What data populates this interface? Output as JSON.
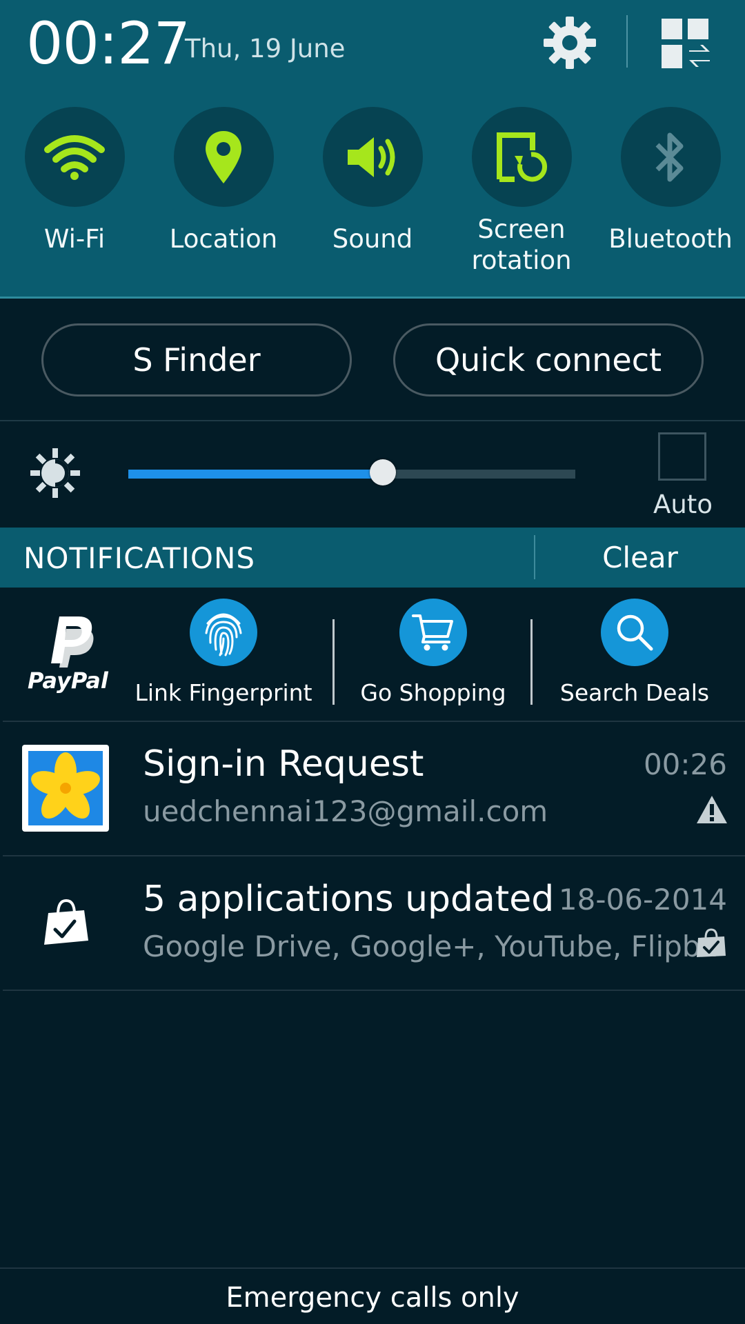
{
  "header": {
    "time": "00:27",
    "date": "Thu, 19 June",
    "settings_icon": "gear-icon",
    "quickpanel_icon": "quick-settings-edit-icon"
  },
  "quick_toggles": [
    {
      "label": "Wi-Fi",
      "icon": "wifi-icon",
      "state": "on"
    },
    {
      "label": "Location",
      "icon": "location-pin-icon",
      "state": "on"
    },
    {
      "label": "Sound",
      "icon": "speaker-icon",
      "state": "on"
    },
    {
      "label": "Screen\nrotation",
      "icon": "screen-rotation-icon",
      "state": "on"
    },
    {
      "label": "Bluetooth",
      "icon": "bluetooth-icon",
      "state": "off"
    }
  ],
  "buttons": {
    "s_finder": "S Finder",
    "quick_connect": "Quick connect"
  },
  "brightness": {
    "level": 0.57,
    "auto_label": "Auto",
    "auto_checked": false
  },
  "notifications_bar": {
    "title": "NOTIFICATIONS",
    "clear_label": "Clear"
  },
  "paypal": {
    "logo_text": "PayPal",
    "actions": [
      {
        "label": "Link Fingerprint",
        "icon": "fingerprint-icon"
      },
      {
        "label": "Go Shopping",
        "icon": "shopping-cart-icon"
      },
      {
        "label": "Search Deals",
        "icon": "search-icon"
      }
    ]
  },
  "notifications": [
    {
      "title": "Sign-in Request",
      "subtitle": "uedchennai123@gmail.com",
      "time": "00:26",
      "app_icon": "photo-app-icon",
      "status_icon": "warning-icon"
    },
    {
      "title": "5 applications updated",
      "subtitle": "Google Drive, Google+, YouTube, Flipb..",
      "time": "18-06-2014",
      "app_icon": "store-bag-check-icon",
      "status_icon": "store-bag-check-icon"
    }
  ],
  "footer": {
    "text": "Emergency calls only"
  },
  "colors": {
    "header_bg": "#0a5c6f",
    "body_bg": "#031c27",
    "toggle_on": "#a6e61c",
    "toggle_off": "#5b8a96",
    "slider_fill": "#1e90e8",
    "paypal_circle": "#1596d8"
  }
}
